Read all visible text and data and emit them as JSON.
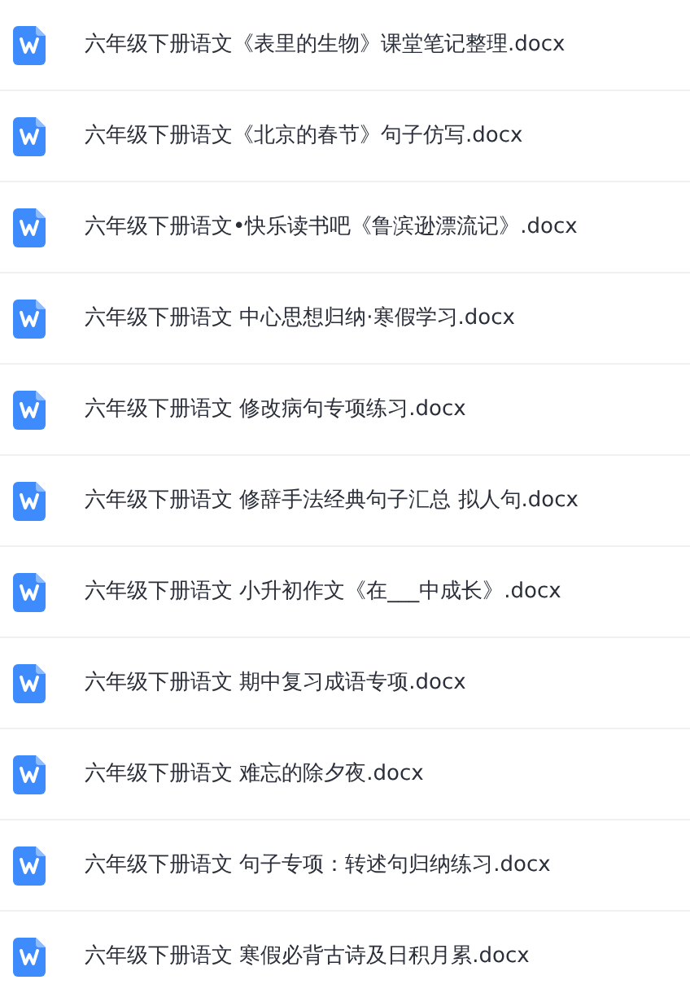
{
  "files": [
    {
      "name": "六年级下册语文《表里的生物》课堂笔记整理.docx"
    },
    {
      "name": "六年级下册语文《北京的春节》句子仿写.docx"
    },
    {
      "name": "六年级下册语文•快乐读书吧《鲁滨逊漂流记》.docx"
    },
    {
      "name": "六年级下册语文 中心思想归纳·寒假学习.docx"
    },
    {
      "name": "六年级下册语文 修改病句专项练习.docx"
    },
    {
      "name": "六年级下册语文 修辞手法经典句子汇总 拟人句.docx"
    },
    {
      "name": "六年级下册语文 小升初作文《在___中成长》.docx"
    },
    {
      "name": "六年级下册语文 期中复习成语专项.docx"
    },
    {
      "name": "六年级下册语文 难忘的除夕夜.docx"
    },
    {
      "name": "六年级下册语文 句子专项：转述句归纳练习.docx"
    },
    {
      "name": "六年级下册语文 寒假必背古诗及日积月累.docx"
    }
  ]
}
